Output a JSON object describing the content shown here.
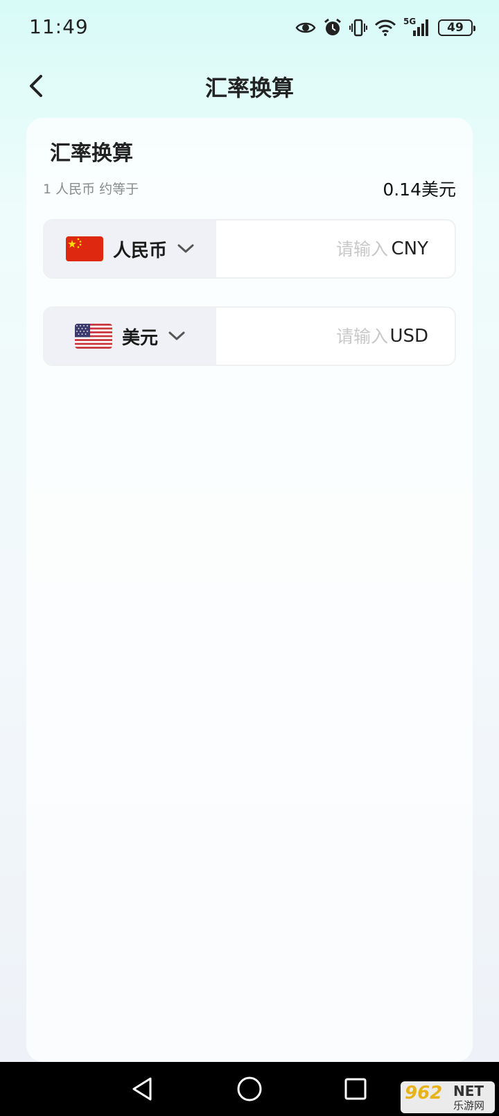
{
  "status_bar": {
    "time": "11:49",
    "network": "5G",
    "battery": "49"
  },
  "header": {
    "title": "汇率换算"
  },
  "card": {
    "title": "汇率换算",
    "rate_note": "1 人民币 约等于",
    "rate_value": "0.14美元"
  },
  "currencies": [
    {
      "name": "人民币",
      "code": "CNY",
      "placeholder": "请输入",
      "value": "",
      "flag": "china-flag-icon"
    },
    {
      "name": "美元",
      "code": "USD",
      "placeholder": "请输入",
      "value": "",
      "flag": "usa-flag-icon"
    }
  ],
  "watermark": {
    "number": "962",
    "net": "NET",
    "site": "乐游网"
  },
  "colors": {
    "background_top": "#d8fbf7",
    "selector_bg": "#eff1f6",
    "flag_red": "#de2910",
    "flag_yellow": "#ffde00",
    "placeholder": "#c8c8c8"
  }
}
